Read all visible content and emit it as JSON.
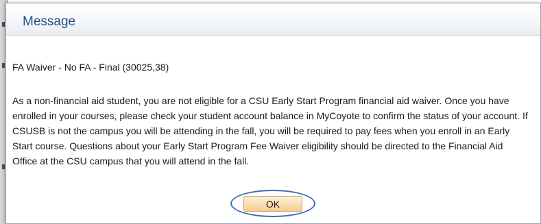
{
  "dialog": {
    "title": "Message",
    "subject": "FA Waiver - No FA - Final (30025,38)",
    "message": "As a non-financial aid student, you are not eligible for a CSU Early Start Program financial aid waiver.  Once you have enrolled in your courses, please check your student account balance in MyCoyote to confirm the status of your account.  If CSUSB is not the campus you will be attending in the fall, you will be required to pay fees when you enroll in an Early Start course.  Questions about your Early Start Program Fee Waiver eligibility should be directed to the Financial Aid Office at the CSU campus that you will attend in the fall.",
    "ok_label": "OK"
  },
  "colors": {
    "title_text": "#27508a",
    "ok_button": "#f9dfb1",
    "highlight_ring": "#3c6eb0"
  }
}
